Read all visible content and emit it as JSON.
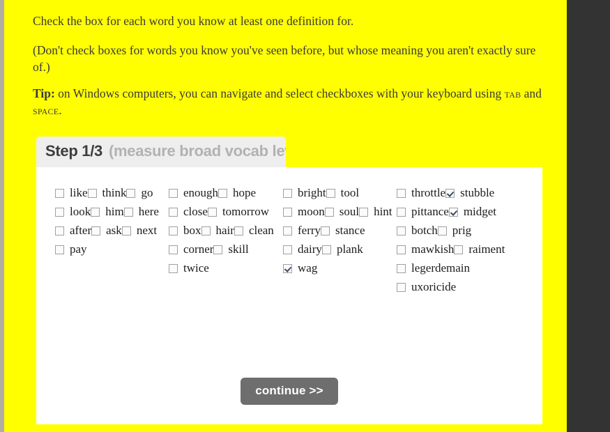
{
  "page": {
    "background_color": "#ffff00",
    "right_strip_color": "#333333"
  },
  "intro": {
    "line_1": "Check the box for each word you know at least one definition for.",
    "line_2": "(Don't check boxes for words you know you've seen before, but whose meaning you aren't exactly sure of.)",
    "tip_lead": "Tip:",
    "tip_part_1": " on Windows computers, you can navigate and select checkboxes with your keyboard using ",
    "tip_key_1": "tab",
    "tip_part_2": " and ",
    "tip_key_2": "space",
    "tip_part_3": "."
  },
  "step_header": {
    "label": "Step 1/3",
    "subtitle": "(measure broad vocab level)",
    "background_color": "#eeeeee",
    "label_color": "#3d3d3d",
    "subtitle_color": "#b2b2b2"
  },
  "word_columns": [
    {
      "words": [
        {
          "label": "like",
          "checked": false
        },
        {
          "label": "think",
          "checked": false
        },
        {
          "label": "go",
          "checked": false
        },
        {
          "label": "look",
          "checked": false
        },
        {
          "label": "him",
          "checked": false
        },
        {
          "label": "here",
          "checked": false
        },
        {
          "label": "after",
          "checked": false
        },
        {
          "label": "ask",
          "checked": false
        },
        {
          "label": "next",
          "checked": false
        },
        {
          "label": "pay",
          "checked": false
        }
      ]
    },
    {
      "words": [
        {
          "label": "enough",
          "checked": false
        },
        {
          "label": "hope",
          "checked": false
        },
        {
          "label": "close",
          "checked": false
        },
        {
          "label": "tomorrow",
          "checked": false
        },
        {
          "label": "box",
          "checked": false
        },
        {
          "label": "hair",
          "checked": false
        },
        {
          "label": "clean",
          "checked": false
        },
        {
          "label": "corner",
          "checked": false
        },
        {
          "label": "skill",
          "checked": false
        },
        {
          "label": "twice",
          "checked": false
        }
      ]
    },
    {
      "words": [
        {
          "label": "bright",
          "checked": false
        },
        {
          "label": "tool",
          "checked": false
        },
        {
          "label": "moon",
          "checked": false
        },
        {
          "label": "soul",
          "checked": false
        },
        {
          "label": "hint",
          "checked": false
        },
        {
          "label": "ferry",
          "checked": false
        },
        {
          "label": "stance",
          "checked": false
        },
        {
          "label": "dairy",
          "checked": false
        },
        {
          "label": "plank",
          "checked": false
        },
        {
          "label": "wag",
          "checked": true
        }
      ]
    },
    {
      "words": [
        {
          "label": "throttle",
          "checked": false
        },
        {
          "label": "stubble",
          "checked": true
        },
        {
          "label": "pittance",
          "checked": false
        },
        {
          "label": "midget",
          "checked": true
        },
        {
          "label": "botch",
          "checked": false
        },
        {
          "label": "prig",
          "checked": false
        },
        {
          "label": "mawkish",
          "checked": false
        },
        {
          "label": "raiment",
          "checked": false
        },
        {
          "label": "legerdemain",
          "checked": false
        },
        {
          "label": "uxoricide",
          "checked": false
        }
      ]
    }
  ],
  "continue": {
    "label": "continue >>",
    "background_color": "#6e6e6e",
    "text_color": "#ffffff"
  }
}
